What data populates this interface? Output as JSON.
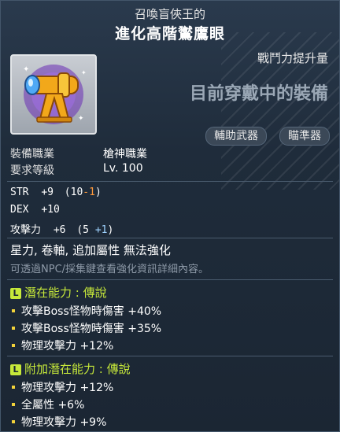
{
  "header": {
    "subtitle": "召喚盲俠王的",
    "title": "進化高階鸑鷹眼",
    "stat_label": "戰鬥力提升量",
    "equipped": "目前穿戴中的裝備"
  },
  "tags": [
    "輔助武器",
    "瞄準器"
  ],
  "icon_name": "golden-telescope-icon",
  "requirements": [
    {
      "label": "裝備職業",
      "value": "槍神職業"
    },
    {
      "label": "要求等級",
      "value": "Lv. 100"
    }
  ],
  "stats": {
    "str": {
      "label": "STR",
      "value": "+9",
      "open": "(10",
      "mod": "-1",
      "close": ")"
    },
    "dex": {
      "label": "DEX",
      "value": "+10"
    },
    "att": {
      "label": "攻擊力",
      "value": "+6",
      "open": "(5",
      "mod": "+1",
      "close": ")"
    }
  },
  "notice": "星力, 卷軸, 追加屬性 無法強化",
  "hint": "可透過NPC/採集鍵查看強化資訊詳細內容。",
  "potential": {
    "badge": "L",
    "title": "潛在能力 : 傳說",
    "lines": [
      "攻擊Boss怪物時傷害 +40%",
      "攻擊Boss怪物時傷害 +35%",
      "物理攻擊力 +12%"
    ]
  },
  "additional_potential": {
    "badge": "L",
    "title": "附加潛在能力 : 傳說",
    "lines": [
      "物理攻擊力 +12%",
      "全屬性 +6%",
      "物理攻擊力 +9%"
    ]
  },
  "colors": {
    "legendary": "#c6e83a",
    "minus": "#ff9a3c",
    "plus": "#9fd3ff"
  }
}
